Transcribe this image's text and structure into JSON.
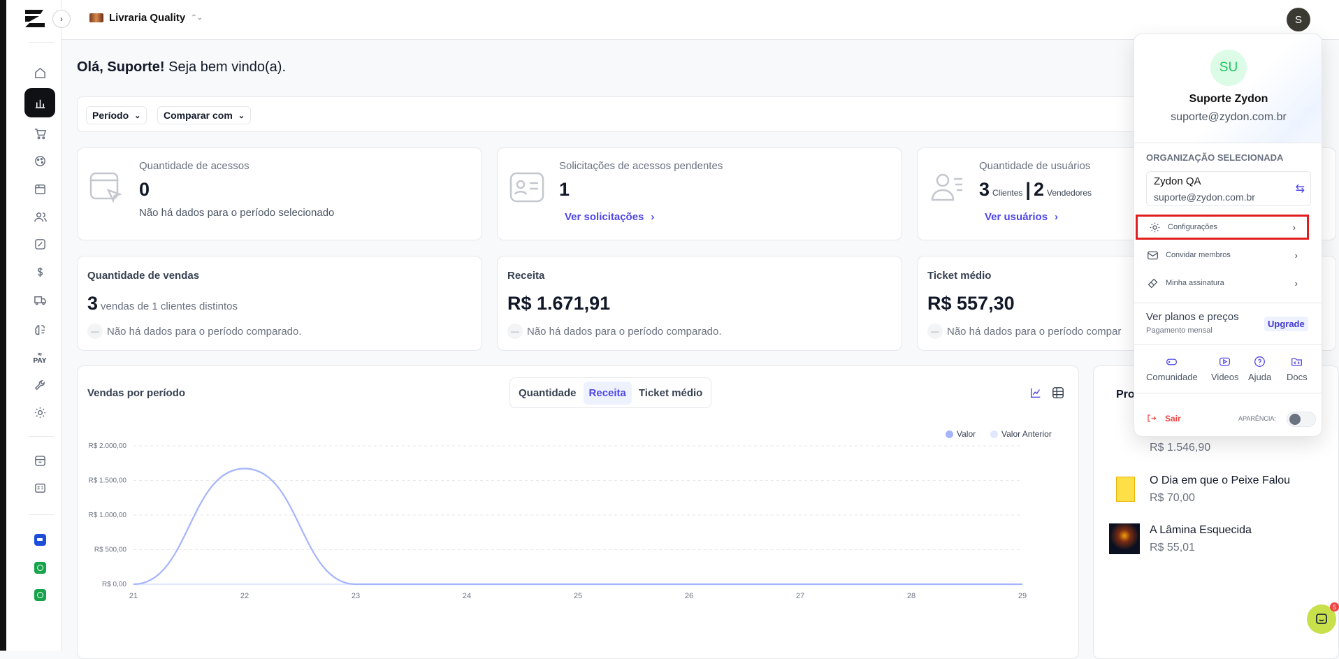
{
  "topbar": {
    "store_name": "Livraria Quality",
    "avatar_initial": "S"
  },
  "greeting": {
    "hello": "Olá, Suporte!",
    "welcome": "Seja bem vindo(a)."
  },
  "filters": {
    "period": "Período",
    "compare": "Comparar com"
  },
  "cards": {
    "accesses": {
      "title": "Quantidade de acessos",
      "value": "0",
      "note": "Não há dados para o período selecionado"
    },
    "pending": {
      "title": "Solicitações de acessos pendentes",
      "value": "1",
      "link": "Ver solicitações"
    },
    "users": {
      "title": "Quantidade de usuários",
      "clients_value": "3",
      "clients_label": "Clientes",
      "sellers_value": "2",
      "sellers_label": "Vendedores",
      "link": "Ver usuários"
    },
    "sales": {
      "title": "Quantidade de vendas",
      "value": "3",
      "suffix": "vendas de 1 clientes distintos",
      "note": "Não há dados para o período comparado."
    },
    "revenue": {
      "title": "Receita",
      "value": "R$ 1.671,91",
      "note": "Não há dados para o período comparado."
    },
    "ticket": {
      "title": "Ticket médio",
      "value": "R$ 557,30",
      "note": "Não há dados para o período compar"
    }
  },
  "chart_panel": {
    "title": "Vendas por período",
    "tabs": [
      "Quantidade",
      "Receita",
      "Ticket médio"
    ],
    "active_tab": "Receita"
  },
  "chart_data": {
    "type": "line",
    "x": [
      "21",
      "22",
      "23",
      "24",
      "25",
      "26",
      "27",
      "28",
      "29"
    ],
    "series": [
      {
        "name": "Valor",
        "values": [
          0,
          1671.91,
          0,
          0,
          0,
          0,
          0,
          0,
          0
        ]
      },
      {
        "name": "Valor Anterior",
        "values": [
          0,
          0,
          0,
          0,
          0,
          0,
          0,
          0,
          0
        ]
      }
    ],
    "yticks": [
      "R$ 0,00",
      "R$ 500,00",
      "R$ 1.000,00",
      "R$ 1.500,00",
      "R$ 2.000,00"
    ],
    "ylim": [
      0,
      2000
    ],
    "colors": {
      "Valor": "#a5b4fc",
      "Valor Anterior": "#e0e7ff"
    },
    "legend": "top-right",
    "grid": true
  },
  "products": {
    "title": "Pro",
    "items": [
      {
        "name": "",
        "price": "R$ 1.546,90"
      },
      {
        "name": "O Dia em que o Peixe Falou",
        "price": "R$ 70,00"
      },
      {
        "name": "A Lâmina Esquecida",
        "price": "R$ 55,01"
      }
    ]
  },
  "menu": {
    "initials": "SU",
    "name": "Suporte Zydon",
    "email": "suporte@zydon.com.br",
    "org_section": "ORGANIZAÇÃO SELECIONADA",
    "org_name": "Zydon QA",
    "org_email": "suporte@zydon.com.br",
    "items": [
      "Configurações",
      "Convidar membros",
      "Minha assinatura"
    ],
    "plans": "Ver planos e preços",
    "plans_sub": "Pagamento mensal",
    "upgrade": "Upgrade",
    "help": [
      "Comunidade",
      "Videos",
      "Ajuda",
      "Docs"
    ],
    "logout": "Sair",
    "appearance": "APARÊNCIA:"
  },
  "chat": {
    "badge": "5"
  },
  "colors": {
    "accent": "#4f46e5",
    "highlight": "#e11d1d",
    "success": "#22c55e"
  }
}
